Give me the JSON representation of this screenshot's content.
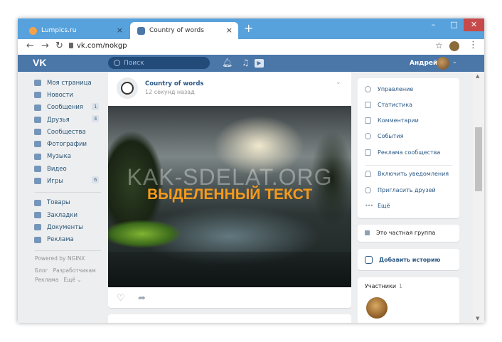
{
  "browser": {
    "tabs": [
      {
        "title": "Lumpics.ru",
        "close": "×"
      },
      {
        "title": "Country of words",
        "close": "×"
      }
    ],
    "new_tab": "+",
    "window_controls": {
      "minimize": "–",
      "maximize": "□",
      "close": "✕"
    },
    "url": "vk.com/nokgp",
    "icons": {
      "back": "back-arrow-icon",
      "forward": "forward-arrow-icon",
      "reload": "reload-icon",
      "lock": "lock-icon",
      "star": "star-icon",
      "menu": "menu-dots-icon"
    }
  },
  "header": {
    "logo": "VK",
    "search_placeholder": "Поиск",
    "user_name": "Андрей",
    "brand_color": "#4a76a8"
  },
  "sidebar": {
    "items": [
      {
        "label": "Моя страница",
        "count": ""
      },
      {
        "label": "Новости",
        "count": ""
      },
      {
        "label": "Сообщения",
        "count": "1"
      },
      {
        "label": "Друзья",
        "count": "4"
      },
      {
        "label": "Сообщества",
        "count": ""
      },
      {
        "label": "Фотографии",
        "count": ""
      },
      {
        "label": "Музыка",
        "count": ""
      },
      {
        "label": "Видео",
        "count": ""
      },
      {
        "label": "Игры",
        "count": "6"
      }
    ],
    "items2": [
      {
        "label": "Товары"
      },
      {
        "label": "Закладки"
      },
      {
        "label": "Документы"
      },
      {
        "label": "Реклама"
      }
    ],
    "powered": "Powered by NGINX",
    "footer": {
      "blog": "Блог",
      "dev": "Разработчикам",
      "ads": "Реклама",
      "more": "Ещё ⌄"
    }
  },
  "post": {
    "author": "Country of words",
    "time": "12 секунд назад",
    "watermark": "KAK-SDELAT.ORG",
    "overlay_text": "ВЫДЕЛЕННЫЙ ТЕКСТ"
  },
  "right": {
    "menu": [
      {
        "label": "Управление"
      },
      {
        "label": "Статистика"
      },
      {
        "label": "Комментарии"
      },
      {
        "label": "События"
      },
      {
        "label": "Реклама сообщества"
      },
      {
        "label": "Включить уведомления"
      },
      {
        "label": "Пригласить друзей"
      },
      {
        "label": "Ещё"
      }
    ],
    "private": "Это частная группа",
    "add_story": "Добавить историю",
    "members_title": "Участники",
    "members_count": "1"
  }
}
